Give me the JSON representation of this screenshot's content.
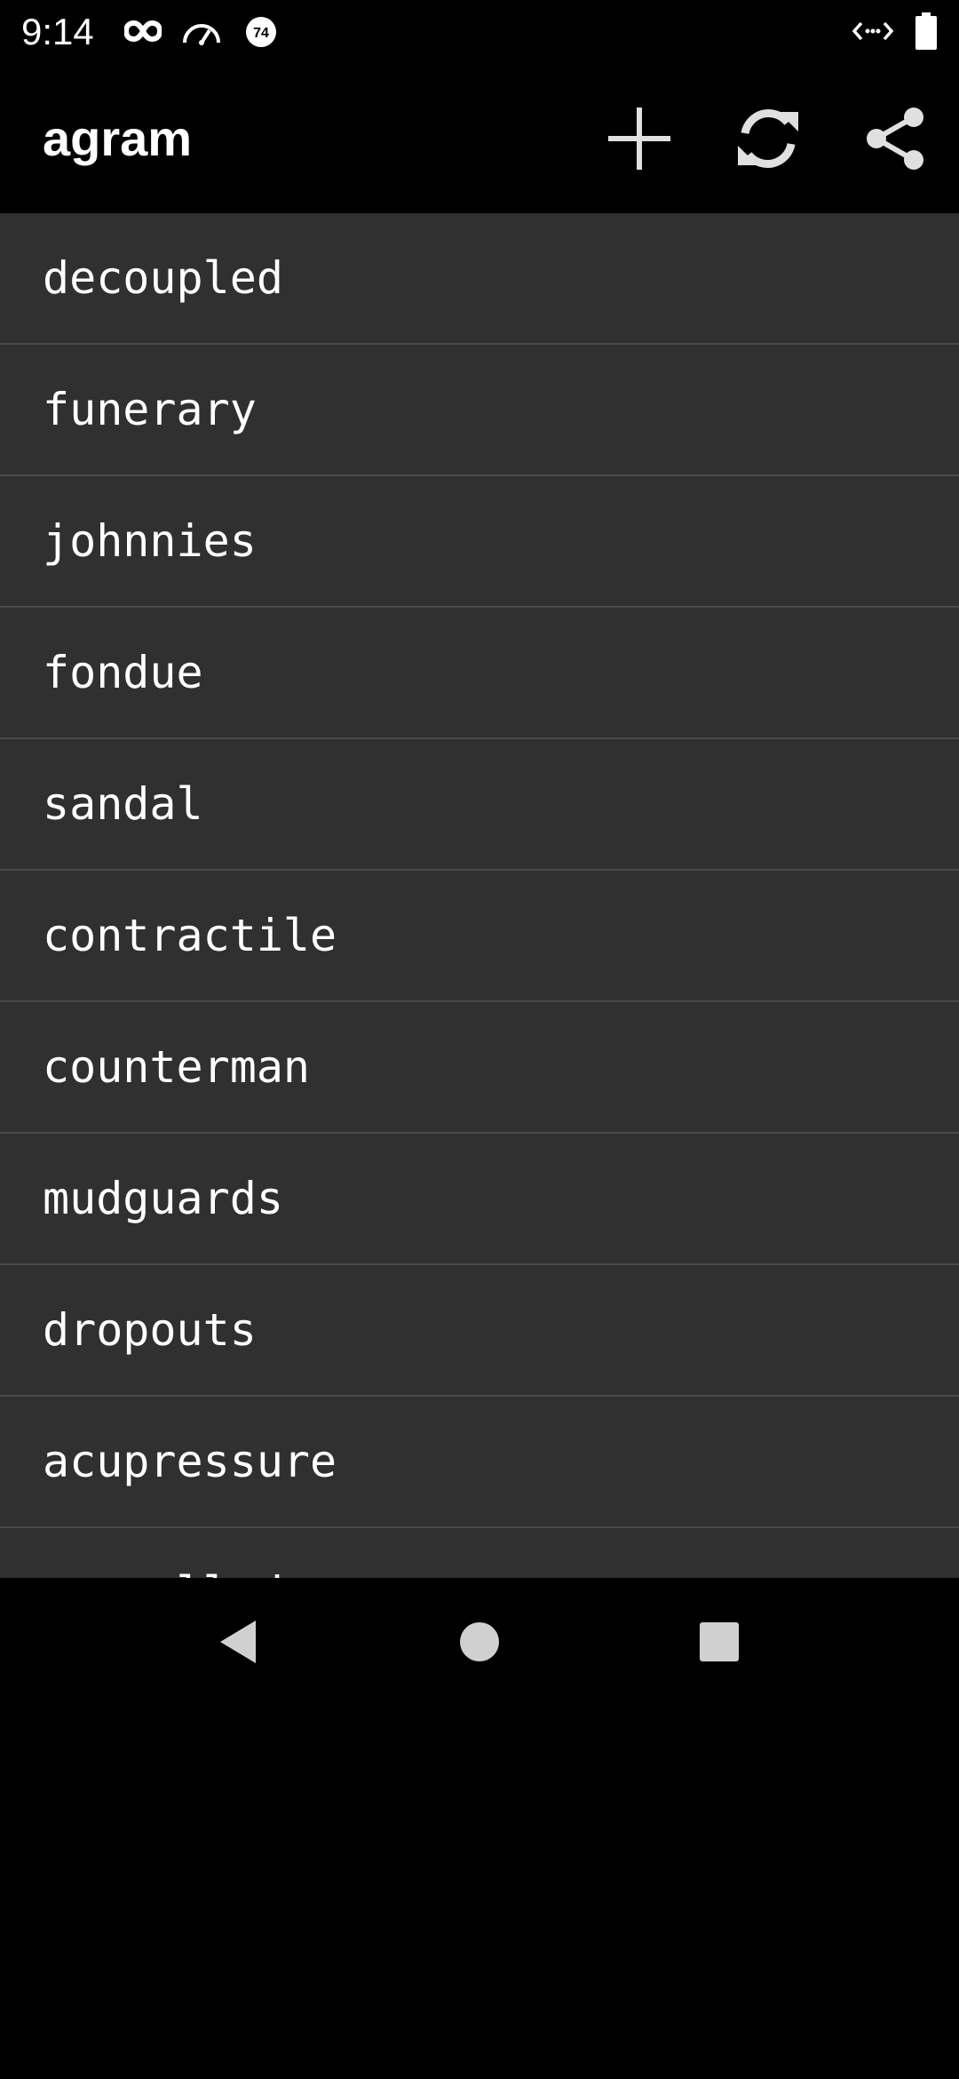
{
  "status_bar": {
    "time": "9:14",
    "badge_number": "74",
    "icons": [
      "infinity-icon",
      "speedometer-icon",
      "notification-badge-icon",
      "data-saver-icon",
      "battery-icon"
    ]
  },
  "app_bar": {
    "title": "agram",
    "actions": [
      {
        "name": "add",
        "icon": "plus-icon"
      },
      {
        "name": "refresh",
        "icon": "refresh-icon"
      },
      {
        "name": "share",
        "icon": "share-icon"
      }
    ]
  },
  "words": [
    {
      "label": "decoupled"
    },
    {
      "label": "funerary"
    },
    {
      "label": "johnnies"
    },
    {
      "label": "fondue"
    },
    {
      "label": "sandal"
    },
    {
      "label": "contractile"
    },
    {
      "label": "counterman"
    },
    {
      "label": "mudguards"
    },
    {
      "label": "dropouts"
    },
    {
      "label": "acupressure"
    },
    {
      "label": "compelled"
    }
  ],
  "nav_bar": {
    "buttons": [
      "back-icon",
      "home-icon",
      "recents-icon"
    ]
  },
  "colors": {
    "background": "#000000",
    "list_background": "#303030",
    "divider": "#4a4a4a",
    "text": "#ffffff",
    "icon": "#e0e0e0"
  }
}
